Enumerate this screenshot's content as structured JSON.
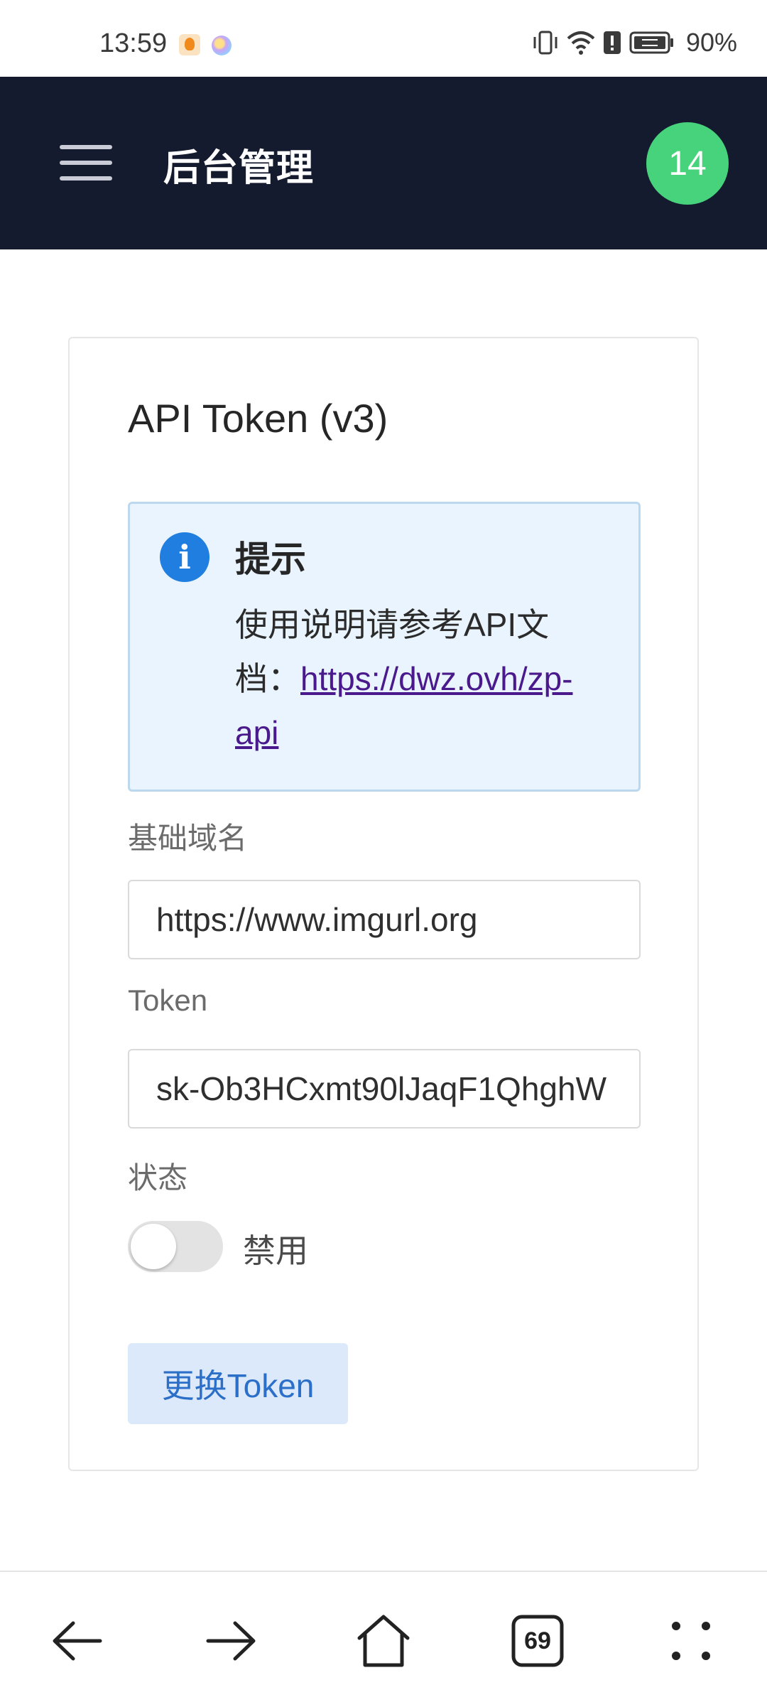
{
  "status_bar": {
    "time": "13:59",
    "battery": "90%",
    "icons": [
      "vibrate-icon",
      "wifi-icon",
      "alert-icon",
      "battery-icon"
    ]
  },
  "app_bar": {
    "title": "后台管理",
    "avatar_text": "14",
    "avatar_color": "#47d27c",
    "background": "#151b2e"
  },
  "card": {
    "title": "API Token (v3)",
    "notice": {
      "title": "提示",
      "text": "使用说明请参考API文档：",
      "link": "https://dwz.ovh/zp-api"
    },
    "base_domain": {
      "label": "基础域名",
      "value": "https://www.imgurl.org"
    },
    "token": {
      "label": "Token",
      "value": "sk-Ob3HCxmt90lJaqF1QhghW"
    },
    "status": {
      "label": "状态",
      "toggle_label": "禁用",
      "enabled": false
    },
    "button_label": "更换Token"
  },
  "bottom_nav": {
    "tabs_count": "69",
    "items": [
      "back-icon",
      "forward-icon",
      "home-icon",
      "tabs-icon",
      "more-icon"
    ]
  }
}
